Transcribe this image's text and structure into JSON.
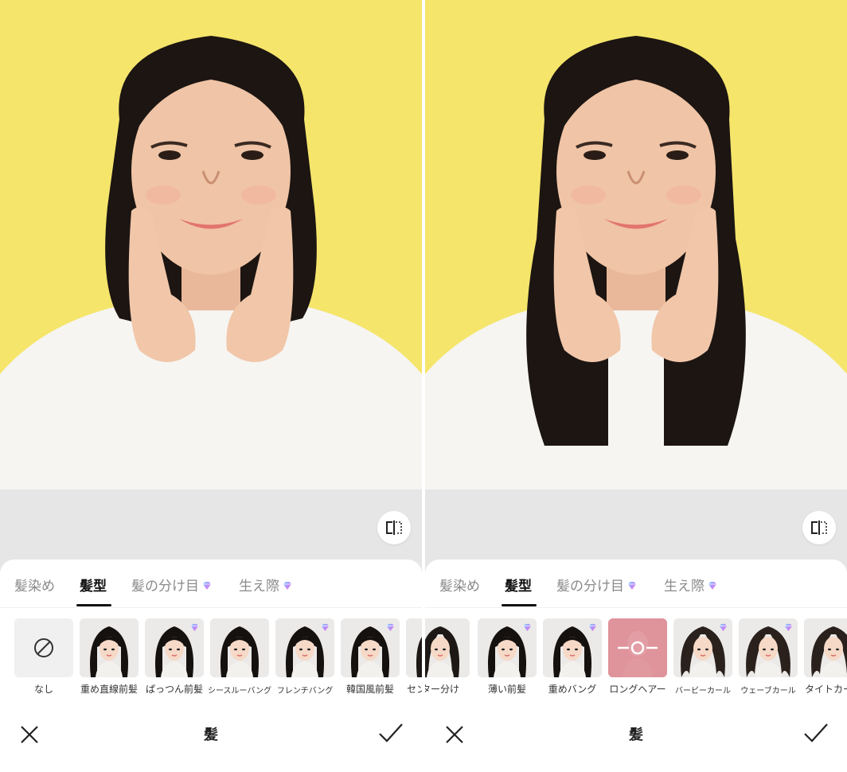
{
  "panels": [
    {
      "tabs": [
        {
          "label": "髪染め",
          "active": false,
          "premium": false
        },
        {
          "label": "髪型",
          "active": true,
          "premium": false
        },
        {
          "label": "髪の分け目",
          "active": false,
          "premium": true
        },
        {
          "label": "生え際",
          "active": false,
          "premium": true
        }
      ],
      "styles": [
        {
          "label": "なし",
          "kind": "none",
          "premium": false
        },
        {
          "label": "重め直線前髪",
          "kind": "bangs",
          "premium": false
        },
        {
          "label": "ぱっつん前髪",
          "kind": "bangs",
          "premium": true
        },
        {
          "label": "シースルーバング",
          "kind": "bangs",
          "premium": false,
          "small": true
        },
        {
          "label": "フレンチバング",
          "kind": "bangs",
          "premium": true,
          "small": true
        },
        {
          "label": "韓国風前髪",
          "kind": "bangs",
          "premium": true
        },
        {
          "label": "センター分け",
          "kind": "center",
          "premium": false
        }
      ],
      "title": "髪"
    },
    {
      "tabs": [
        {
          "label": "髪染め",
          "active": false,
          "premium": false
        },
        {
          "label": "髪型",
          "active": true,
          "premium": false
        },
        {
          "label": "髪の分け目",
          "active": false,
          "premium": true
        },
        {
          "label": "生え際",
          "active": false,
          "premium": true
        }
      ],
      "styles": [
        {
          "label": "ター分け",
          "kind": "center",
          "premium": false
        },
        {
          "label": "薄い前髪",
          "kind": "bangs",
          "premium": true
        },
        {
          "label": "重めバング",
          "kind": "bangs",
          "premium": true
        },
        {
          "label": "ロングヘアー",
          "kind": "selected",
          "premium": false
        },
        {
          "label": "バービーカール",
          "kind": "curl",
          "premium": true,
          "small": true
        },
        {
          "label": "ウェーブカール",
          "kind": "curl",
          "premium": true,
          "small": true
        },
        {
          "label": "タイトカール",
          "kind": "curl",
          "premium": false
        }
      ],
      "title": "髪"
    }
  ],
  "colors": {
    "background_yellow": "#f5e56b",
    "selected_pink": "#d9767f",
    "active_tab": "#111111"
  },
  "icons": [
    "compare-icon",
    "close-icon",
    "check-icon",
    "gem-icon",
    "none-icon"
  ]
}
